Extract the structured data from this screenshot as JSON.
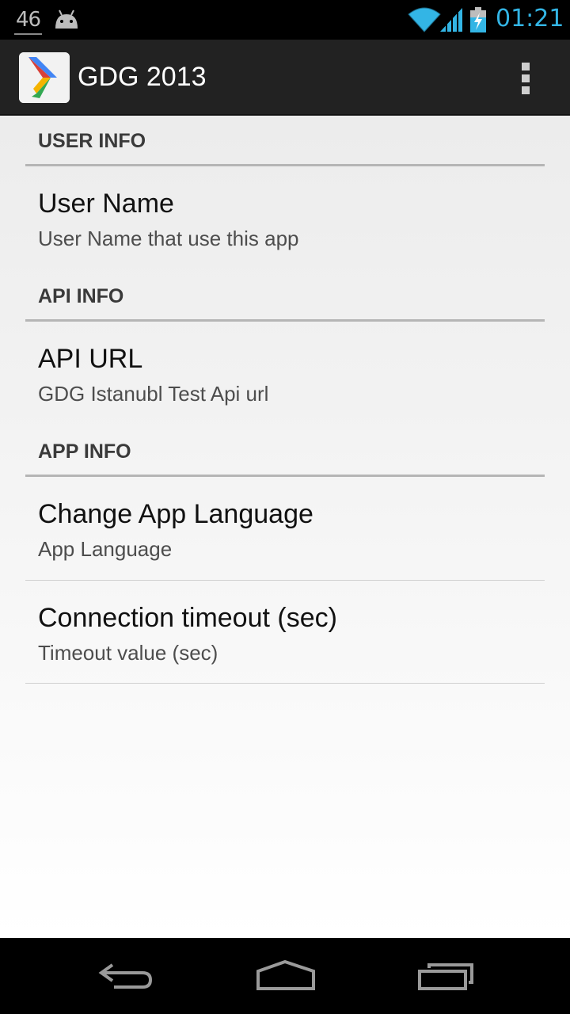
{
  "status_bar": {
    "notification_count": "46",
    "clock": "01:21",
    "icons": [
      "android-icon",
      "wifi-icon",
      "signal-icon",
      "battery-charging-icon"
    ],
    "clock_color": "#33b5e5"
  },
  "action_bar": {
    "title": "GDG 2013",
    "app_icon": "gdg-logo-icon",
    "overflow_icon": "overflow-menu-icon",
    "background": "#222222"
  },
  "preferences": {
    "user_info": {
      "header": "USER INFO",
      "user_name": {
        "title": "User Name",
        "summary": "User Name that use this app"
      }
    },
    "api_info": {
      "header": "API INFO",
      "api_url": {
        "title": "API URL",
        "summary": "GDG Istanubl Test Api url"
      }
    },
    "app_info": {
      "header": "APP INFO",
      "app_language": {
        "title": "Change App Language",
        "summary": "App Language"
      },
      "connection_timeout": {
        "title": "Connection timeout (sec)",
        "summary": "Timeout value (sec)"
      }
    }
  },
  "nav_bar": {
    "buttons": [
      "back-icon",
      "home-icon",
      "recent-apps-icon"
    ]
  }
}
